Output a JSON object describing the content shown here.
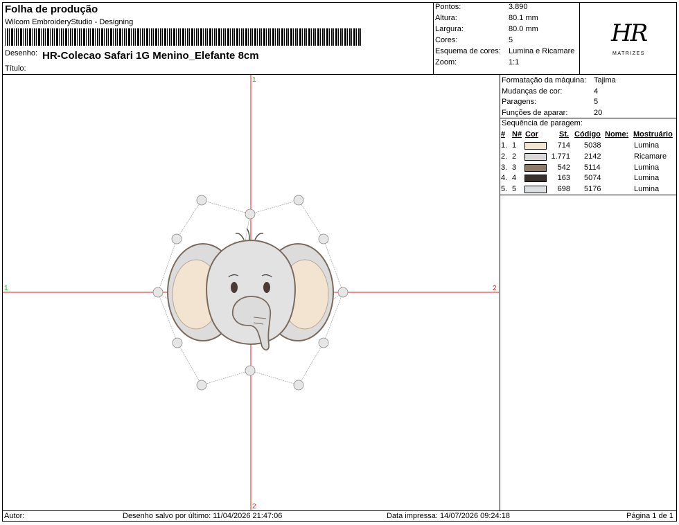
{
  "header": {
    "title": "Folha de produção",
    "software": "Wilcom EmbroideryStudio - Designing",
    "design_label": "Desenho:",
    "design_name": "HR-Colecao Safari 1G Menino_Elefante 8cm",
    "title_label": "Título:"
  },
  "specs": [
    {
      "label": "Pontos:",
      "value": "3.890"
    },
    {
      "label": "Altura:",
      "value": "80.1 mm"
    },
    {
      "label": "Largura:",
      "value": "80.0 mm"
    },
    {
      "label": "Cores:",
      "value": "5"
    },
    {
      "label": "Esquema de cores:",
      "value": "Lumina e Ricamare"
    },
    {
      "label": "Zoom:",
      "value": "1:1"
    }
  ],
  "logo": {
    "mark": "HR",
    "sub": "MATRIZES"
  },
  "machine": [
    {
      "label": "Formatação da máquina:",
      "value": "Tajima"
    },
    {
      "label": "Mudanças de cor:",
      "value": "4"
    },
    {
      "label": "Paragens:",
      "value": "5"
    },
    {
      "label": "Funções de aparar:",
      "value": "20"
    }
  ],
  "sequence": {
    "title": "Sequência de paragem:",
    "headers": {
      "idx": "#",
      "n": "N#",
      "color": "Cor",
      "st": "St.",
      "code": "Código",
      "name": "Nome:",
      "chart": "Mostruário"
    },
    "rows": [
      {
        "idx": "1.",
        "n": "1",
        "color": "#f5e6d3",
        "st": "714",
        "code": "5038",
        "chart": "Lumina"
      },
      {
        "idx": "2.",
        "n": "2",
        "color": "#d9d9d9",
        "st": "1.771",
        "code": "2142",
        "chart": "Ricamare"
      },
      {
        "idx": "3.",
        "n": "3",
        "color": "#8c7a6b",
        "st": "542",
        "code": "5114",
        "chart": "Lumina"
      },
      {
        "idx": "4.",
        "n": "4",
        "color": "#3a302b",
        "st": "163",
        "code": "5074",
        "chart": "Lumina"
      },
      {
        "idx": "5.",
        "n": "5",
        "color": "#dde0e2",
        "st": "698",
        "code": "5176",
        "chart": "Lumina"
      }
    ]
  },
  "axes": {
    "top": "1",
    "left": "1",
    "right": "2",
    "bottom": "2",
    "axis_color": "#e0201e"
  },
  "footer": {
    "author": "Autor:",
    "saved": "Desenho salvo por último: 11/04/2026 21:47:06",
    "printed": "Data impressa: 14/07/2026 09:24:18",
    "page": "Página 1 de 1"
  }
}
